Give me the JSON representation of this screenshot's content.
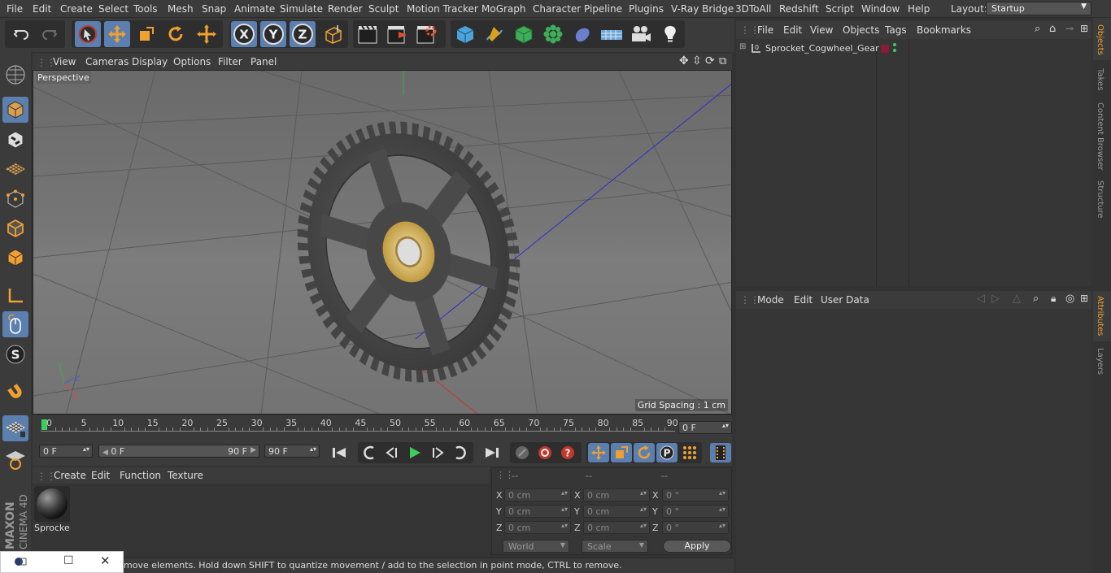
{
  "menubar": {
    "items": [
      "File",
      "Edit",
      "Create",
      "Select",
      "Tools",
      "Mesh",
      "Snap",
      "Animate",
      "Simulate",
      "Render",
      "Sculpt",
      "Motion Tracker",
      "MoGraph",
      "Character",
      "Pipeline",
      "Plugins",
      "V-Ray Bridge",
      "3DToAll",
      "Redshift",
      "Script",
      "Window",
      "Help"
    ],
    "layout_label": "Layout:",
    "layout_value": "Startup"
  },
  "toolbar": {
    "tools": [
      "undo-icon",
      "redo-icon",
      "live-selection-icon",
      "move-icon",
      "scale-icon",
      "rotate-icon",
      "add-icon",
      "x-axis-icon",
      "y-axis-icon",
      "z-axis-icon",
      "coordinate-system-icon",
      "render-view-icon",
      "render-picture-viewer-icon",
      "edit-render-settings-icon",
      "cube-icon",
      "pen-icon",
      "subdivision-icon",
      "cloner-icon",
      "deformer-icon",
      "floor-icon",
      "camera-icon",
      "light-icon"
    ]
  },
  "viewport": {
    "menu": [
      "View",
      "Cameras",
      "Display",
      "Options",
      "Filter",
      "Panel"
    ],
    "camera_label": "Perspective",
    "grid_spacing": "Grid Spacing : 1 cm"
  },
  "timeline": {
    "ticks": [
      "0",
      "5",
      "10",
      "15",
      "20",
      "25",
      "30",
      "35",
      "40",
      "45",
      "50",
      "55",
      "60",
      "65",
      "70",
      "75",
      "80",
      "85",
      "90"
    ],
    "current_frame": "0 F"
  },
  "transport": {
    "start_field": "0 F",
    "range_start": "0 F",
    "range_end": "90 F",
    "end_field": "90 F"
  },
  "material_manager": {
    "menu": [
      "Create",
      "Edit",
      "Function",
      "Texture"
    ],
    "materials": [
      {
        "name": "Sprocke"
      }
    ]
  },
  "coordinates": {
    "headers": [
      "--",
      "--",
      "--"
    ],
    "rows": [
      {
        "axis": "X",
        "pos": "0 cm",
        "size": "0 cm",
        "rot_axis": "X",
        "rot": "0 °"
      },
      {
        "axis": "Y",
        "pos": "0 cm",
        "size": "0 cm",
        "rot_axis": "Y",
        "rot": "0 °"
      },
      {
        "axis": "Z",
        "pos": "0 cm",
        "size": "0 cm",
        "rot_axis": "Z",
        "rot": "0 °"
      }
    ],
    "mode": "World",
    "transform": "Scale",
    "apply_label": "Apply"
  },
  "status": {
    "text": "move elements. Hold down SHIFT to quantize movement / add to the selection in point mode, CTRL to remove."
  },
  "object_manager": {
    "menu": [
      "File",
      "Edit",
      "View",
      "Objects",
      "Tags",
      "Bookmarks"
    ],
    "objects": [
      {
        "name": "Sprocket_Cogwheel_Gear",
        "tag_color": "#8b1a3a"
      }
    ]
  },
  "attributes": {
    "menu": [
      "Mode",
      "Edit",
      "User Data"
    ]
  },
  "right_tabs": [
    "Objects",
    "Takes",
    "Content Browser",
    "Structure",
    "Attributes",
    "Layers"
  ],
  "brand": {
    "name": "MAXON",
    "product": "CINEMA 4D"
  },
  "colors": {
    "accent_blue": "#5b7fae",
    "orange": "#f0a030"
  }
}
